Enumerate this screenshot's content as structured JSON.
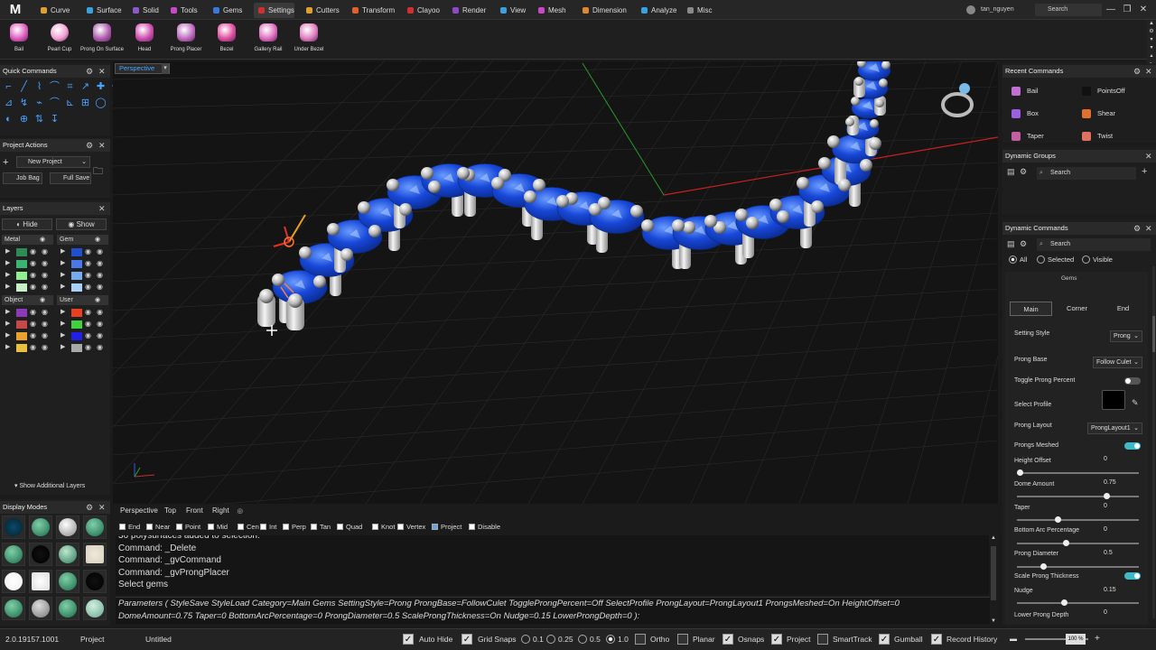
{
  "app": {
    "logo": "M"
  },
  "menu": {
    "tabs": [
      {
        "label": "Curve",
        "color": "#e0a030"
      },
      {
        "label": "Surface",
        "color": "#3aa0e0"
      },
      {
        "label": "Solid",
        "color": "#8a5ac8"
      },
      {
        "label": "Tools",
        "color": "#c848c8"
      },
      {
        "label": "Gems",
        "color": "#3a78e0"
      },
      {
        "label": "Settings",
        "color": "#d03030"
      },
      {
        "label": "Cutters",
        "color": "#e0a030"
      },
      {
        "label": "Transform",
        "color": "#e06030"
      },
      {
        "label": "Clayoo",
        "color": "#d03030"
      },
      {
        "label": "Render",
        "color": "#9048c8"
      },
      {
        "label": "View",
        "color": "#3aa0e0"
      },
      {
        "label": "Mesh",
        "color": "#c848c8"
      },
      {
        "label": "Dimension",
        "color": "#e08830"
      },
      {
        "label": "Analyze",
        "color": "#3aa0e0"
      },
      {
        "label": "Misc",
        "color": "#8a8a8a"
      }
    ],
    "user": "tan_nguyen",
    "search": "Search"
  },
  "ribbon": {
    "tools": [
      "Bail",
      "Pearl Cup",
      "Prong On Surface",
      "Head",
      "Prong Placer",
      "Bezel",
      "Gallery Rail",
      "Under Bezel"
    ]
  },
  "quick_commands": {
    "title": "Quick Commands"
  },
  "project_actions": {
    "title": "Project Actions",
    "project": "New Project",
    "job_bag": "Job Bag",
    "full_save": "Full Save"
  },
  "layers": {
    "title": "Layers",
    "hide": "Hide",
    "show": "Show",
    "groups": [
      "Metal",
      "Gem",
      "Object",
      "User"
    ],
    "show_additional": "Show Additional Layers",
    "metal_colors": [
      "#2e8b57",
      "#3cb371",
      "#90ee90",
      "#c8f0c8"
    ],
    "gem_colors": [
      "#1e50d0",
      "#4a78e8",
      "#78aaf0",
      "#a8d0f8"
    ],
    "object_colors": [
      "#8a3ab8",
      "#c84848",
      "#e8a030",
      "#e8c040"
    ],
    "user_colors": [
      "#e84020",
      "#40d040",
      "#2020e8",
      "#a8a8a8"
    ]
  },
  "display_modes": {
    "title": "Display Modes"
  },
  "viewport": {
    "label": "Perspective"
  },
  "view_tabs": [
    "Perspective",
    "Top",
    "Front",
    "Right"
  ],
  "osnaps": [
    {
      "label": "End",
      "on": true
    },
    {
      "label": "Near",
      "on": true
    },
    {
      "label": "Point",
      "on": true
    },
    {
      "label": "Mid",
      "on": true
    },
    {
      "label": "Cen",
      "on": false
    },
    {
      "label": "Int",
      "on": true
    },
    {
      "label": "Perp",
      "on": true
    },
    {
      "label": "Tan",
      "on": true
    },
    {
      "label": "Quad",
      "on": false
    },
    {
      "label": "Knot",
      "on": false
    },
    {
      "label": "Vertex",
      "on": false
    },
    {
      "label": "Project",
      "on": true
    },
    {
      "label": "Disable",
      "on": false
    }
  ],
  "command_history": [
    "36 polysurfaces added to selection.",
    "Command: _Delete",
    "Command: _gvCommand",
    "Command: _gvProngPlacer",
    "Select gems"
  ],
  "params": {
    "line1": "Parameters ( StyleSave  StyleLoad  Category=Main  Gems  SettingStyle=Prong  ProngBase=FollowCulet  ToggleProngPercent=Off  SelectProfile  ProngLayout=ProngLayout1  ProngsMeshed=On  HeightOffset=0",
    "line2": "DomeAmount=0.75  Taper=0  BottomArcPercentage=0  ProngDiameter=0.5  ScaleProngThickness=On  Nudge=0.15  LowerProngDepth=0 ):"
  },
  "status": {
    "version": "2.0.19157.1001",
    "project": "Project",
    "file": "Untitled",
    "auto_hide": "Auto Hide",
    "grid_snaps": "Grid Snaps",
    "grid_values": [
      "0.1",
      "0.25",
      "0.5",
      "1.0"
    ],
    "grid_selected": "1.0",
    "ortho": "Ortho",
    "planar": "Planar",
    "osnaps": "Osnaps",
    "smarttrack": "SmartTrack",
    "gumball": "Gumball",
    "record_history": "Record History",
    "zoom": "100 %"
  },
  "recent_commands": {
    "title": "Recent Commands",
    "items": [
      "Bail",
      "PointsOff",
      "Box",
      "Shear",
      "Taper",
      "Twist"
    ]
  },
  "dynamic_groups": {
    "title": "Dynamic Groups",
    "search": "Search"
  },
  "dynamic_commands": {
    "title": "Dynamic Commands",
    "search": "Search",
    "filters": [
      "All",
      "Selected",
      "Visible"
    ],
    "gems_label": "Gems",
    "tabs": [
      "Main",
      "Corner",
      "End"
    ],
    "setting_style": {
      "label": "Setting Style",
      "value": "Prong"
    },
    "prong_base": {
      "label": "Prong Base",
      "value": "Follow Culet"
    },
    "toggle_prong_percent": {
      "label": "Toggle Prong Percent",
      "on": false
    },
    "select_profile": {
      "label": "Select Profile"
    },
    "prong_layout": {
      "label": "Prong Layout",
      "value": "ProngLayout1"
    },
    "prongs_meshed": {
      "label": "Prongs Meshed",
      "on": true
    },
    "height_offset": {
      "label": "Height Offset",
      "value": "0",
      "level": 0
    },
    "dome_amount": {
      "label": "Dome Amount",
      "value": "0.75",
      "level": 0.75
    },
    "taper": {
      "label": "Taper",
      "value": "0",
      "level": 0.33
    },
    "bottom_arc": {
      "label": "Bottom Arc Percentage",
      "value": "0",
      "level": 0.4
    },
    "prong_diameter": {
      "label": "Prong Diameter",
      "value": "0.5",
      "level": 0.2
    },
    "scale_prong_thickness": {
      "label": "Scale Prong Thickness",
      "on": true
    },
    "nudge": {
      "label": "Nudge",
      "value": "0.15",
      "level": 0.38
    },
    "lower_prong_depth": {
      "label": "Lower Prong Depth",
      "value": "0"
    }
  }
}
